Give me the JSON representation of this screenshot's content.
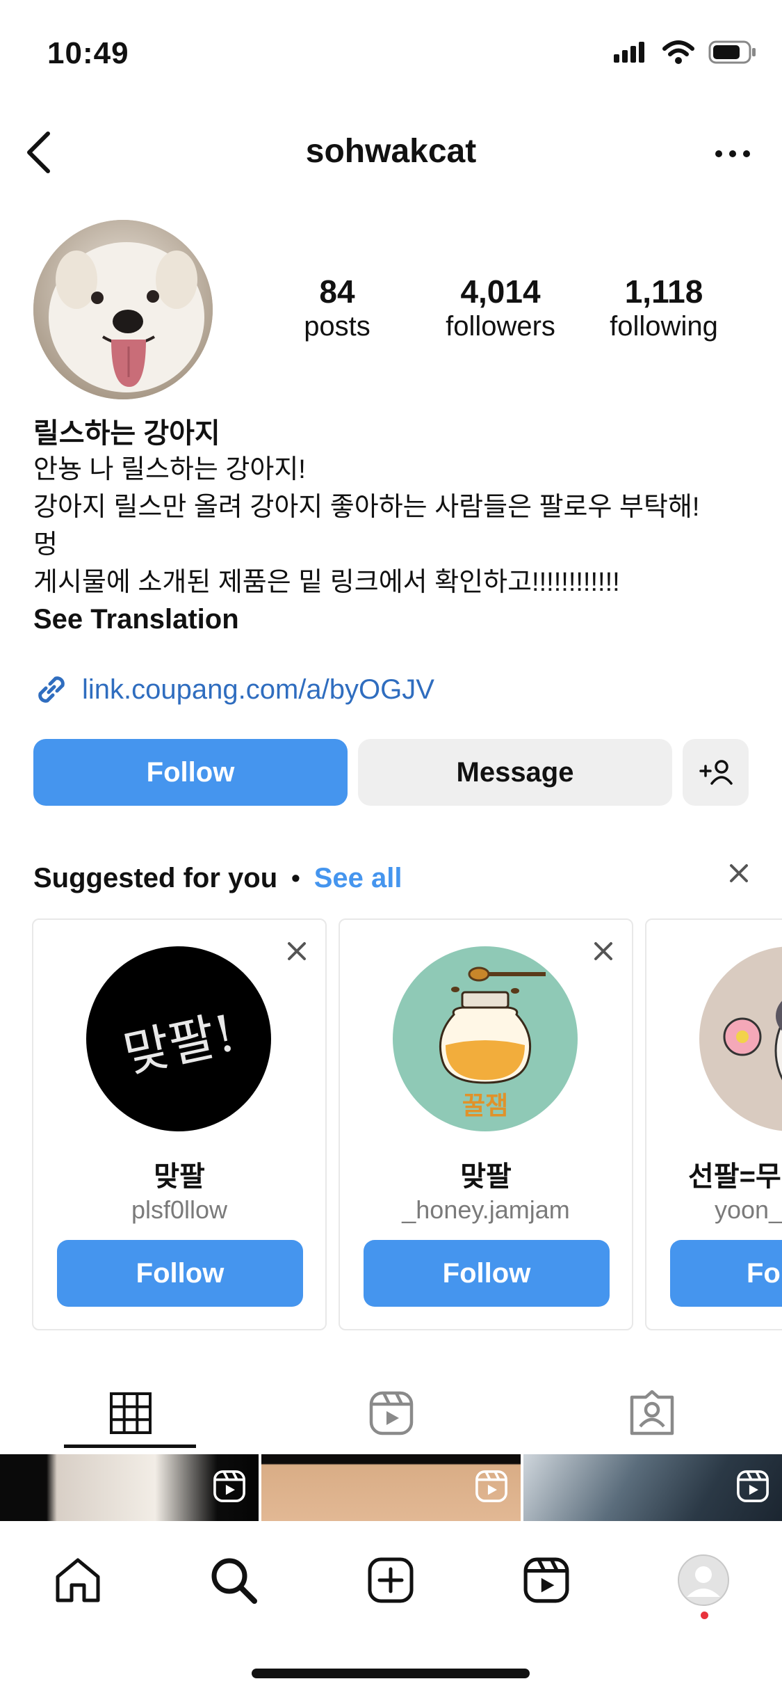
{
  "status_bar": {
    "time": "10:49",
    "icons": [
      "signal-icon",
      "wifi-icon",
      "battery-icon"
    ]
  },
  "header": {
    "username": "sohwakcat",
    "back_icon": "chevron-left-icon",
    "more_icon": "more-horizontal-icon"
  },
  "profile": {
    "stats": [
      {
        "value": "84",
        "label": "posts"
      },
      {
        "value": "4,014",
        "label": "followers"
      },
      {
        "value": "1,118",
        "label": "following"
      }
    ],
    "display_name": "릴스하는 강아지",
    "bio_lines": [
      "안뇽 나 릴스하는 강아지!",
      "강아지 릴스만 올려 강아지 좋아하는 사람들은 팔로우 부탁해!",
      "멍",
      "게시물에 소개된 제품은 밑 링크에서 확인하고!!!!!!!!!!!!"
    ],
    "see_translation": "See Translation",
    "link": "link.coupang.com/a/byOGJV"
  },
  "actions": {
    "follow": "Follow",
    "message": "Message"
  },
  "suggested": {
    "title": "Suggested for you",
    "separator": "•",
    "see_all": "See all",
    "cards": [
      {
        "name": "맞팔",
        "handle": "plsf0llow",
        "follow": "Follow",
        "avatar_text": "맞팔!"
      },
      {
        "name": "맞팔",
        "handle": "_honey.jamjam",
        "follow": "Follow",
        "avatar_text": "꿀잼"
      },
      {
        "name": "선팔=무",
        "handle": "yoon_",
        "follow": "Fo",
        "avatar_text": ""
      }
    ]
  },
  "tabs": [
    "grid-icon",
    "reels-icon",
    "tagged-icon"
  ],
  "bottom_nav": [
    "home-icon",
    "search-icon",
    "create-icon",
    "reels-icon",
    "profile-icon"
  ],
  "colors": {
    "accent": "#4595ee",
    "link": "#2f6dbf",
    "secondary_bg": "#efefef",
    "notification": "#e8323c"
  }
}
